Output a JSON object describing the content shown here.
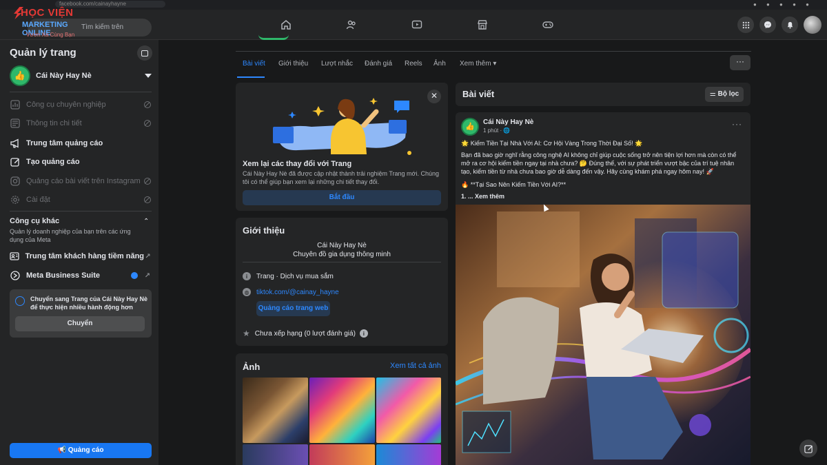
{
  "browser": {
    "url": "facebook.com/cainayhayne"
  },
  "watermark": {
    "brand_line1": "HỌC VIỆN",
    "brand_line2": "MARKETING ONLINE",
    "tagline": "Vươn Xa Cùng Bạn"
  },
  "nav": {
    "search_placeholder": "Tìm kiếm trên Facebook",
    "icons": [
      "home-icon",
      "friends-icon",
      "video-icon",
      "marketplace-icon",
      "gaming-icon"
    ],
    "right_icons": [
      "menu-grid-icon",
      "messenger-icon",
      "bell-icon"
    ]
  },
  "sidebar": {
    "title": "Quản lý trang",
    "page_name": "Cái Này Hay Nè",
    "page_avatar_initials": "👍",
    "items": [
      {
        "label": "Công cụ chuyên nghiệp",
        "disabled": true
      },
      {
        "label": "Thông tin chi tiết",
        "disabled": true
      },
      {
        "label": "Trung tâm quảng cáo",
        "disabled": false
      },
      {
        "label": "Tạo quảng cáo",
        "disabled": false
      },
      {
        "label": "Quảng cáo bài viết trên Instagram",
        "disabled": true
      },
      {
        "label": "Cài đặt",
        "disabled": true
      }
    ],
    "section_title": "Công cụ khác",
    "section_desc": "Quản lý doanh nghiệp của bạn trên các ứng dụng của Meta",
    "tools": [
      {
        "label": "Trung tâm khách hàng tiềm năng"
      },
      {
        "label": "Meta Business Suite"
      }
    ],
    "switch_text": "Chuyển sang Trang của Cái Này Hay Nè để thực hiện nhiều hành động hơn",
    "switch_button": "Chuyển",
    "ad_button": "Quảng cáo"
  },
  "tabs": [
    {
      "label": "Bài viết",
      "active": true
    },
    {
      "label": "Giới thiệu",
      "active": false
    },
    {
      "label": "Lượt nhắc",
      "active": false
    },
    {
      "label": "Đánh giá",
      "active": false
    },
    {
      "label": "Reels",
      "active": false
    },
    {
      "label": "Ảnh",
      "active": false
    },
    {
      "label": "Xem thêm ▾",
      "active": false
    }
  ],
  "tabs_more": "···",
  "update_card": {
    "title": "Xem lại các thay đổi với Trang",
    "desc": "Cái Này Hay Nè đã được cập nhật thành trải nghiệm Trang mới. Chúng tôi có thể giúp bạn xem lại những chi tiết thay đổi.",
    "button": "Bắt đầu",
    "close": "✕"
  },
  "intro": {
    "title": "Giới thiệu",
    "name": "Cái Này Hay Nè",
    "tagline": "Chuyên đồ gia dụng thông minh",
    "category": "Trang · Dịch vụ mua sắm",
    "website": "tiktok.com/@cainay_hayne",
    "web_button": "Quảng cáo trang web",
    "rating": "Chưa xếp hạng (0 lượt đánh giá)"
  },
  "photos": {
    "title": "Ảnh",
    "see_all": "Xem tất cả ảnh"
  },
  "posts": {
    "title": "Bài viết",
    "filter": "Bộ lọc",
    "author": "Cái Này Hay Nè",
    "time": "1 phút · 🌐",
    "headline": "🌟 Kiếm Tiền Tại Nhà Với AI: Cơ Hội Vàng Trong Thời Đại Số! 🌟",
    "body": "Bạn đã bao giờ nghĩ rằng công nghệ AI không chỉ giúp cuộc sống trở nên tiện lợi hơn mà còn có thể mở ra cơ hội kiếm tiền ngay tại nhà chưa? 🤔 Đúng thế, với sự phát triển vượt bậc của trí tuệ nhân tạo, kiếm tiền từ nhà chưa bao giờ dễ dàng đến vậy. Hãy cùng khám phá ngay hôm nay! 🚀",
    "subhead": "🔥 **Tại Sao Nên Kiếm Tiền Với AI?**",
    "more": "1. ... Xem thêm",
    "dots": "···"
  },
  "colors": {
    "accent": "#2d88ff",
    "page_bg": "#18191a",
    "card_bg": "#242526",
    "ad_button": "#1877f2"
  }
}
